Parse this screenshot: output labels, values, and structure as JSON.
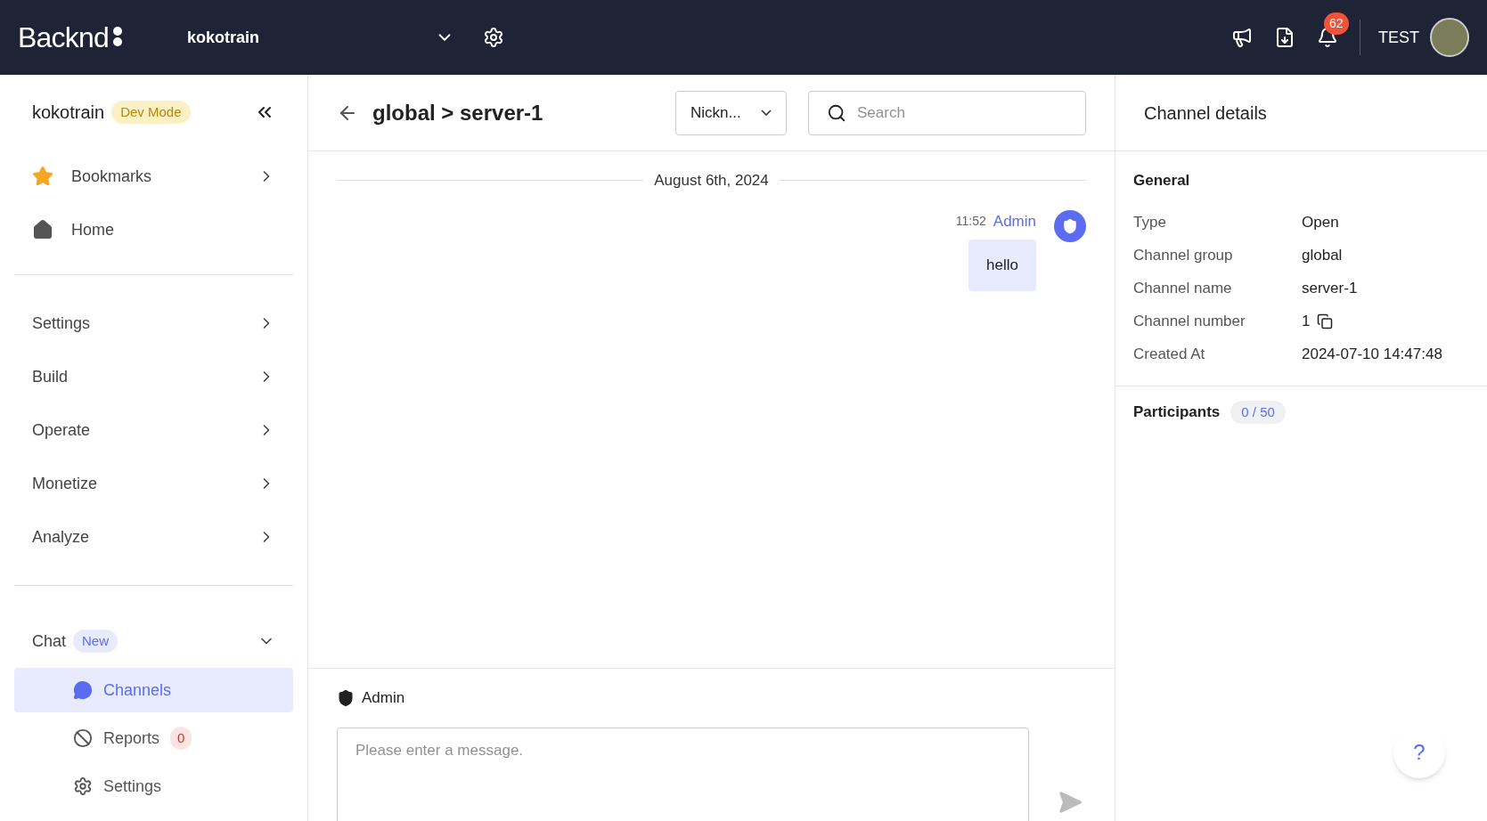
{
  "topbar": {
    "logo": "Backnd",
    "project": "kokotrain",
    "notification_count": "62",
    "user": "TEST"
  },
  "sidebar": {
    "project": "kokotrain",
    "mode_badge": "Dev Mode",
    "top_items": [
      {
        "label": "Bookmarks",
        "kind": "star",
        "has_submenu": true
      },
      {
        "label": "Home",
        "kind": "home",
        "has_submenu": false
      }
    ],
    "menu_items": [
      {
        "label": "Settings"
      },
      {
        "label": "Build"
      },
      {
        "label": "Operate"
      },
      {
        "label": "Monetize"
      },
      {
        "label": "Analyze"
      }
    ],
    "chat": {
      "label": "Chat",
      "badge": "New",
      "expanded": true,
      "children": [
        {
          "label": "Channels",
          "kind": "channels",
          "selected": true
        },
        {
          "label": "Reports",
          "kind": "reports",
          "selected": false,
          "badge": "0"
        },
        {
          "label": "Settings",
          "kind": "settings",
          "selected": false
        }
      ]
    }
  },
  "main": {
    "title": "global > server-1",
    "filter": "Nickn...",
    "search": {
      "placeholder": "Search"
    },
    "date": "August 6th, 2024",
    "messages": [
      {
        "time": "11:52",
        "author": "Admin",
        "text": "hello"
      }
    ],
    "composer": {
      "sender": "Admin",
      "placeholder": "Please enter a message."
    }
  },
  "details": {
    "title": "Channel details",
    "general": {
      "title": "General",
      "rows": [
        {
          "label": "Type",
          "value": "Open",
          "copyable": false
        },
        {
          "label": "Channel group",
          "value": "global",
          "copyable": false
        },
        {
          "label": "Channel name",
          "value": "server-1",
          "copyable": false
        },
        {
          "label": "Channel number",
          "value": "1",
          "copyable": true
        },
        {
          "label": "Created At",
          "value": "2024-07-10 14:47:48",
          "copyable": false
        }
      ]
    },
    "participants": {
      "title": "Participants",
      "count": "0 / 50"
    }
  },
  "help": "?"
}
